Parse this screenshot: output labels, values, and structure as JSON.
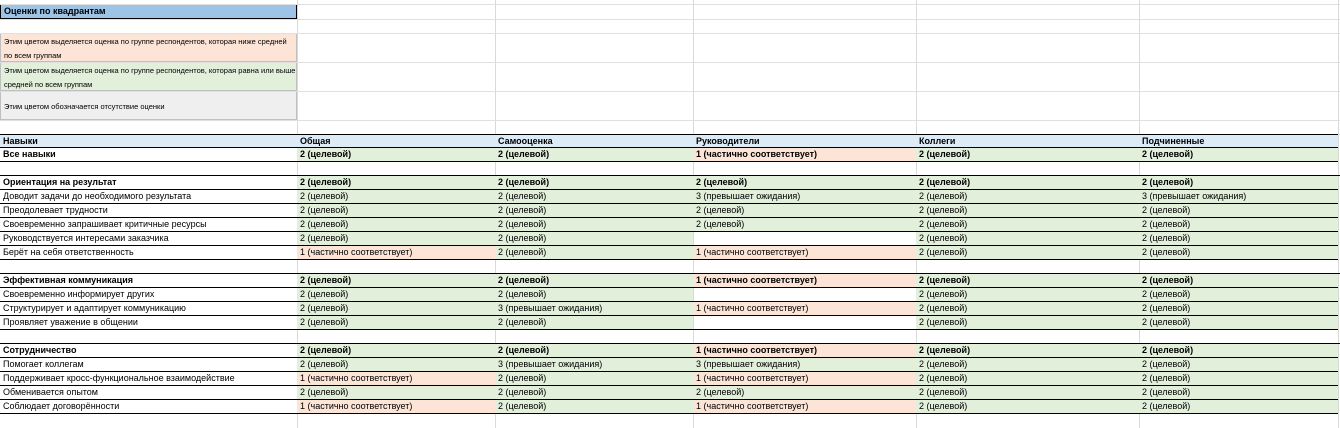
{
  "title": "Оценки по квадрантам",
  "legend": [
    {
      "text": "Этим цветом выделяется оценка по группе респондентов, которая ниже средней по всем группам",
      "color": "orange"
    },
    {
      "text": "Этим цветом выделяется оценка по группе респондентов, которая равна или выше средней по всем группам",
      "color": "green"
    },
    {
      "text": "Этим цветом обозначается отсутствие оценки",
      "color": "grey"
    }
  ],
  "colors": {
    "orange": "#fce4d6",
    "green": "#e2efda",
    "grey": "#efefef",
    "header": "#ddebf7",
    "title": "#9dc3e6"
  },
  "columns": [
    "Навыки",
    "Общая",
    "Самооценка",
    "Руководители",
    "Коллеги",
    "Подчиненные"
  ],
  "rows": [
    {
      "name": "Все навыки",
      "bold": true,
      "cells": [
        [
          "2 (целевой)",
          "g"
        ],
        [
          "2 (целевой)",
          "g"
        ],
        [
          "1 (частично соответствует)",
          "o"
        ],
        [
          "2 (целевой)",
          "g"
        ],
        [
          "2 (целевой)",
          "g"
        ]
      ]
    },
    {
      "spacer": true
    },
    {
      "name": "Ориентация на результат",
      "bold": true,
      "cells": [
        [
          "2 (целевой)",
          "g"
        ],
        [
          "2 (целевой)",
          "g"
        ],
        [
          "2 (целевой)",
          "g"
        ],
        [
          "2 (целевой)",
          "g"
        ],
        [
          "2 (целевой)",
          "g"
        ]
      ]
    },
    {
      "name": "Доводит задачи до необходимого результата",
      "cells": [
        [
          "2 (целевой)",
          "g"
        ],
        [
          "2 (целевой)",
          "g"
        ],
        [
          "3 (превышает ожидания)",
          "g"
        ],
        [
          "2 (целевой)",
          "g"
        ],
        [
          "3 (превышает ожидания)",
          "g"
        ]
      ]
    },
    {
      "name": "Преодолевает трудности",
      "cells": [
        [
          "2 (целевой)",
          "g"
        ],
        [
          "2 (целевой)",
          "g"
        ],
        [
          "2 (целевой)",
          "g"
        ],
        [
          "2 (целевой)",
          "g"
        ],
        [
          "2 (целевой)",
          "g"
        ]
      ]
    },
    {
      "name": "Своевременно запрашивает критичные ресурсы",
      "cells": [
        [
          "2 (целевой)",
          "g"
        ],
        [
          "2 (целевой)",
          "g"
        ],
        [
          "2 (целевой)",
          "g"
        ],
        [
          "2 (целевой)",
          "g"
        ],
        [
          "2 (целевой)",
          "g"
        ]
      ]
    },
    {
      "name": "Руководствуется интересами заказчика",
      "cells": [
        [
          "2 (целевой)",
          "g"
        ],
        [
          "2 (целевой)",
          "g"
        ],
        [
          "",
          "n"
        ],
        [
          "2 (целевой)",
          "g"
        ],
        [
          "2 (целевой)",
          "g"
        ]
      ]
    },
    {
      "name": "Берёт на себя ответственность",
      "cells": [
        [
          "1 (частично соответствует)",
          "o"
        ],
        [
          "2 (целевой)",
          "g"
        ],
        [
          "1 (частично соответствует)",
          "o"
        ],
        [
          "2 (целевой)",
          "g"
        ],
        [
          "2 (целевой)",
          "g"
        ]
      ]
    },
    {
      "spacer": true
    },
    {
      "name": "Эффективная коммуникация",
      "bold": true,
      "cells": [
        [
          "2 (целевой)",
          "g"
        ],
        [
          "2 (целевой)",
          "g"
        ],
        [
          "1 (частично соответствует)",
          "o"
        ],
        [
          "2 (целевой)",
          "g"
        ],
        [
          "2 (целевой)",
          "g"
        ]
      ]
    },
    {
      "name": "Своевременно информирует других",
      "cells": [
        [
          "2 (целевой)",
          "g"
        ],
        [
          "2 (целевой)",
          "g"
        ],
        [
          "",
          "n"
        ],
        [
          "2 (целевой)",
          "g"
        ],
        [
          "2 (целевой)",
          "g"
        ]
      ]
    },
    {
      "name": "Структурирует и адаптирует коммуникацию",
      "cells": [
        [
          "2 (целевой)",
          "g"
        ],
        [
          "3 (превышает ожидания)",
          "g"
        ],
        [
          "1 (частично соответствует)",
          "o"
        ],
        [
          "2 (целевой)",
          "g"
        ],
        [
          "2 (целевой)",
          "g"
        ]
      ]
    },
    {
      "name": "Проявляет уважение в общении",
      "cells": [
        [
          "2 (целевой)",
          "g"
        ],
        [
          "2 (целевой)",
          "g"
        ],
        [
          "",
          "n"
        ],
        [
          "2 (целевой)",
          "g"
        ],
        [
          "2 (целевой)",
          "g"
        ]
      ]
    },
    {
      "spacer": true
    },
    {
      "name": "Сотрудничество",
      "bold": true,
      "cells": [
        [
          "2 (целевой)",
          "g"
        ],
        [
          "2 (целевой)",
          "g"
        ],
        [
          "1 (частично соответствует)",
          "o"
        ],
        [
          "2 (целевой)",
          "g"
        ],
        [
          "2 (целевой)",
          "g"
        ]
      ]
    },
    {
      "name": "Помогает коллегам",
      "cells": [
        [
          "2 (целевой)",
          "g"
        ],
        [
          "3 (превышает ожидания)",
          "g"
        ],
        [
          "3 (превышает ожидания)",
          "g"
        ],
        [
          "2 (целевой)",
          "g"
        ],
        [
          "2 (целевой)",
          "g"
        ]
      ]
    },
    {
      "name": "Поддерживает кросс-функциональное взаимодействие",
      "cells": [
        [
          "1 (частично соответствует)",
          "o"
        ],
        [
          "2 (целевой)",
          "g"
        ],
        [
          "1 (частично соответствует)",
          "o"
        ],
        [
          "2 (целевой)",
          "g"
        ],
        [
          "2 (целевой)",
          "g"
        ]
      ]
    },
    {
      "name": "Обменивается опытом",
      "cells": [
        [
          "2 (целевой)",
          "g"
        ],
        [
          "2 (целевой)",
          "g"
        ],
        [
          "2 (целевой)",
          "g"
        ],
        [
          "2 (целевой)",
          "g"
        ],
        [
          "2 (целевой)",
          "g"
        ]
      ]
    },
    {
      "name": "Соблюдает договорённости",
      "cells": [
        [
          "1 (частично соответствует)",
          "o"
        ],
        [
          "2 (целевой)",
          "g"
        ],
        [
          "1 (частично соответствует)",
          "o"
        ],
        [
          "2 (целевой)",
          "g"
        ],
        [
          "2 (целевой)",
          "g"
        ]
      ]
    }
  ]
}
